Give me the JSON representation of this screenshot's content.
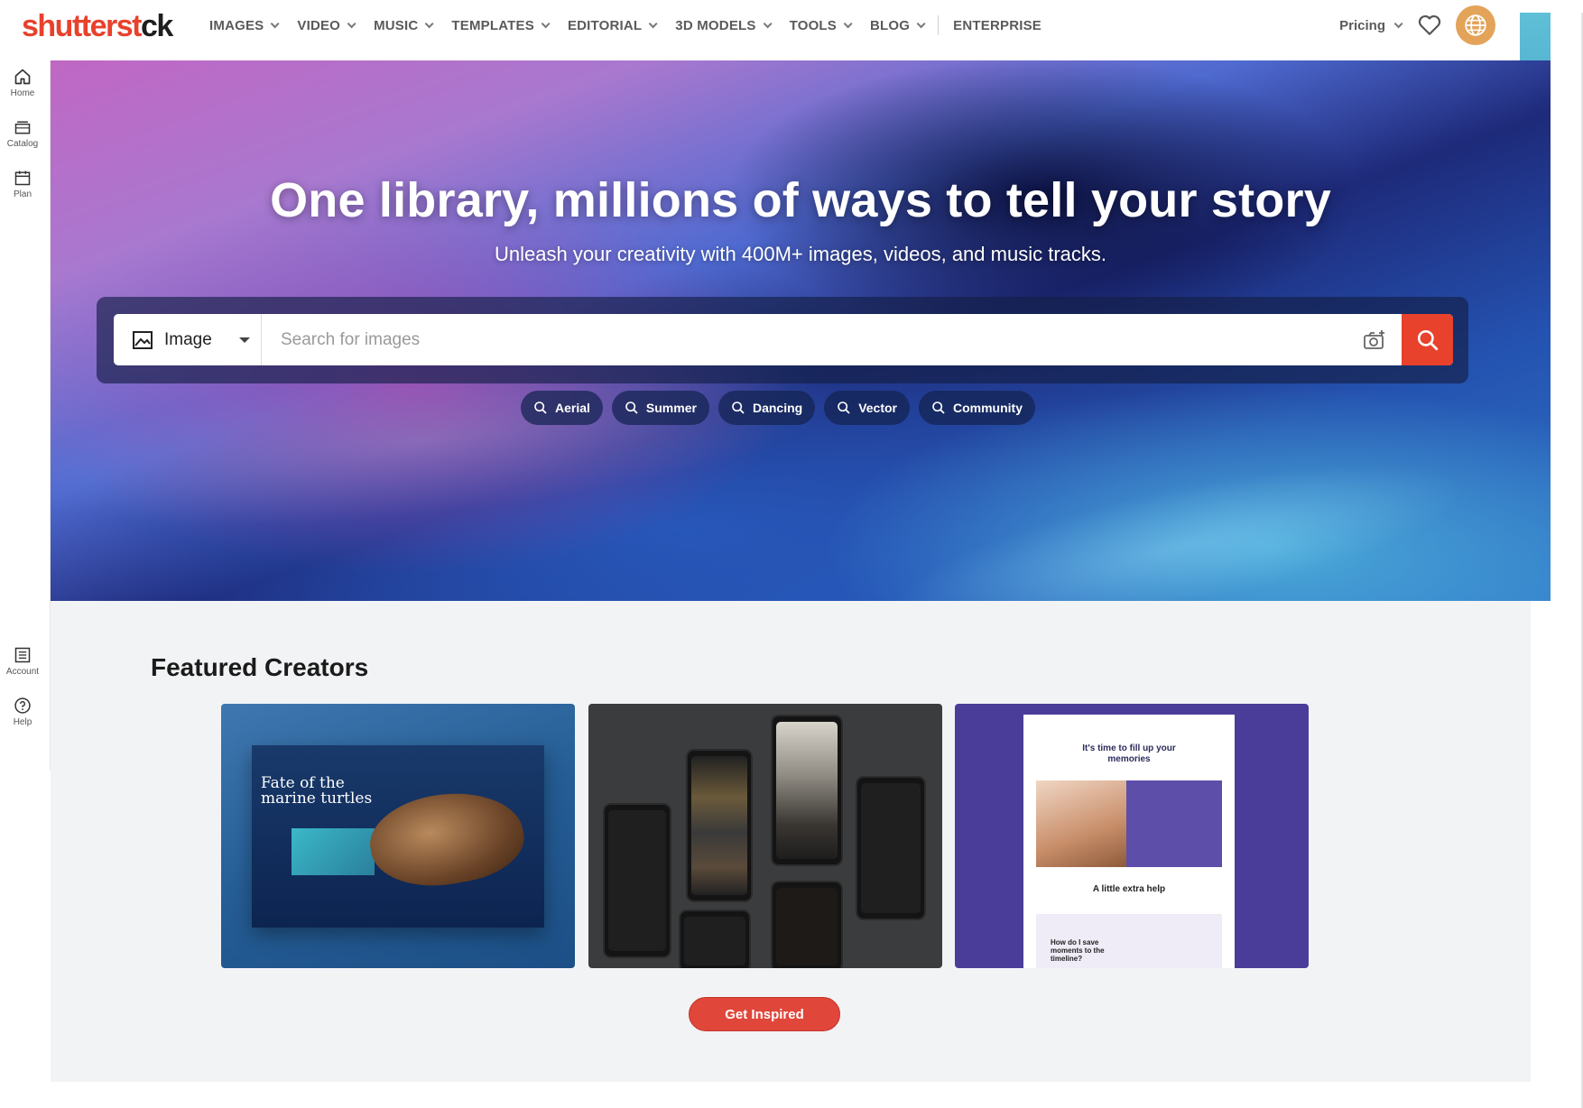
{
  "brand": {
    "logo_a": "shutterst",
    "logo_b": "ck"
  },
  "nav": {
    "items": [
      {
        "label": "IMAGES"
      },
      {
        "label": "VIDEO"
      },
      {
        "label": "MUSIC"
      },
      {
        "label": "TEMPLATES"
      },
      {
        "label": "EDITORIAL"
      },
      {
        "label": "3D MODELS"
      },
      {
        "label": "TOOLS"
      },
      {
        "label": "BLOG"
      }
    ],
    "enterprise": "ENTERPRISE",
    "pricing": "Pricing"
  },
  "rail": {
    "home": "Home",
    "catalog": "Catalog",
    "plan": "Plan",
    "account": "Account",
    "help": "Help"
  },
  "hero": {
    "title": "One library, millions of ways to tell your story",
    "subtitle": "Unleash your creativity with 400M+ images, videos, and music tracks."
  },
  "search": {
    "type": "Image",
    "placeholder": "Search for images",
    "chips": [
      "Aerial",
      "Summer",
      "Dancing",
      "Vector",
      "Community"
    ]
  },
  "featured": {
    "title": "Featured Creators",
    "card1_title_a": "Fate of the",
    "card1_title_b": "marine turtles",
    "card3_heading_a": "It's time to fill up your",
    "card3_heading_b": "memories",
    "card3_mid": "A little extra help",
    "card3_q_a": "How do I save",
    "card3_q_b": "moments to the",
    "card3_q_c": "timeline?",
    "cta": "Get Inspired"
  },
  "colors": {
    "accent": "#e8412c",
    "cta": "#e0463a",
    "globe": "#e3a45a"
  }
}
